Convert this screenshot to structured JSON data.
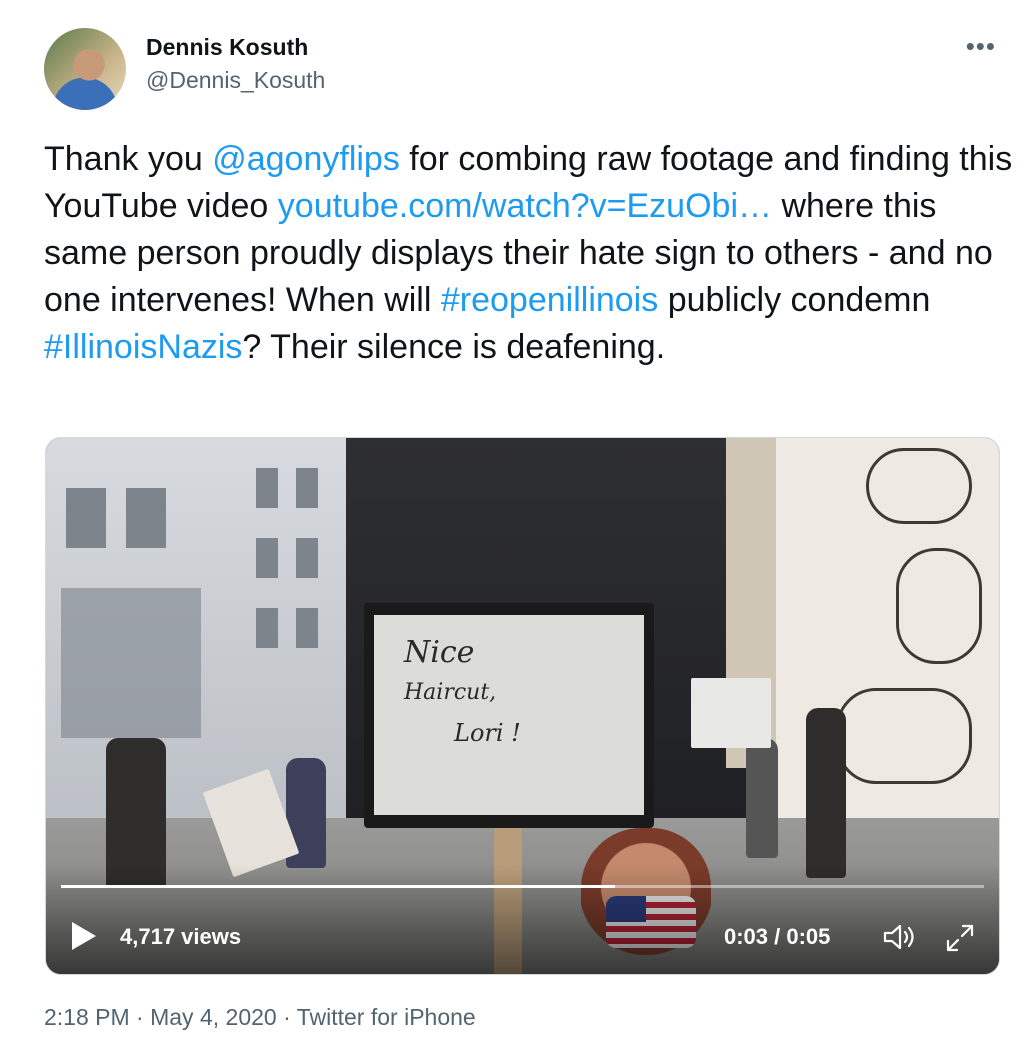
{
  "author": {
    "name": "Dennis Kosuth",
    "handle": "@Dennis_Kosuth",
    "avatar_icon": "profile-photo"
  },
  "more_icon": "more-horizontal-icon",
  "tweet": {
    "segments": [
      {
        "text": "Thank you ",
        "link": false
      },
      {
        "text": "@agonyflips",
        "link": true
      },
      {
        "text": " for combing  raw footage and finding this YouTube video ",
        "link": false
      },
      {
        "text": "youtube.com/watch?v=EzuObi…",
        "link": true
      },
      {
        "text": " where this same person proudly displays their hate sign to others - and no one intervenes! When will ",
        "link": false
      },
      {
        "text": "#reopenillinois",
        "link": true
      },
      {
        "text": " publicly condemn ",
        "link": false
      },
      {
        "text": "#IllinoisNazis",
        "link": true
      },
      {
        "text": "? Their silence is deafening.",
        "link": false
      }
    ]
  },
  "video": {
    "sign_text": [
      "Nice",
      "Haircut,",
      "Lori !"
    ],
    "views": "4,717 views",
    "time": "0:03 / 0:05",
    "progress_fraction": 0.6,
    "play_icon": "play-icon",
    "volume_icon": "volume-icon",
    "expand_icon": "fullscreen-icon"
  },
  "meta": {
    "time": "2:18 PM",
    "separator": " · ",
    "date": "May 4, 2020",
    "source": "Twitter for iPhone"
  },
  "colors": {
    "link": "#1d9bf0",
    "secondary_text": "#536471",
    "primary_text": "#0f1419"
  }
}
